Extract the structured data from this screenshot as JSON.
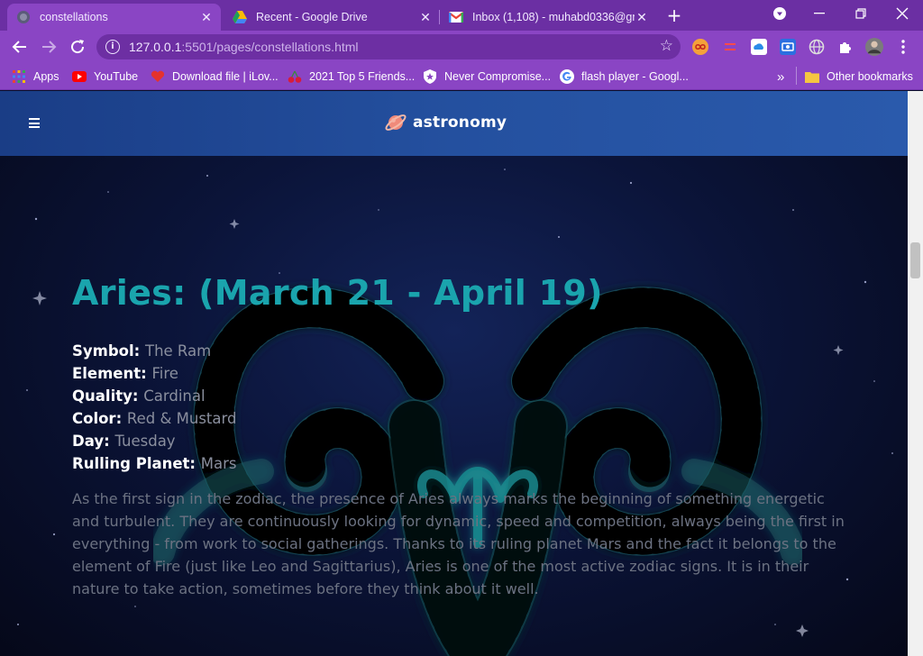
{
  "browser": {
    "tabs": [
      {
        "title": "constellations",
        "active": true
      },
      {
        "title": "Recent - Google Drive",
        "active": false
      },
      {
        "title": "Inbox (1,108) - muhabd0336@gn",
        "active": false
      }
    ],
    "url_host": "127.0.0.1",
    "url_rest": ":5501/pages/constellations.html",
    "bookmarks": [
      {
        "label": "Apps",
        "icon": "apps-grid-icon"
      },
      {
        "label": "YouTube",
        "icon": "youtube-icon"
      },
      {
        "label": "Download file | iLov...",
        "icon": "heart-icon"
      },
      {
        "label": "2021 Top 5 Friends...",
        "icon": "cherries-icon"
      },
      {
        "label": "Never Compromise...",
        "icon": "shield-icon"
      },
      {
        "label": "flash player - Googl...",
        "icon": "google-icon"
      }
    ],
    "other_bookmarks": "Other bookmarks",
    "overflow": "»"
  },
  "site": {
    "logo_text": "astronomy"
  },
  "sign": {
    "title": "Aries: (March 21 - April 19)",
    "facts": [
      {
        "label": "Symbol:",
        "value": "The Ram"
      },
      {
        "label": "Element:",
        "value": "Fire"
      },
      {
        "label": "Quality:",
        "value": "Cardinal"
      },
      {
        "label": "Color:",
        "value": "Red & Mustard"
      },
      {
        "label": "Day:",
        "value": "Tuesday"
      },
      {
        "label": "Rulling Planet:",
        "value": "Mars"
      }
    ],
    "description": "As the first sign in the zodiac, the presence of Aries always marks the beginning of something energetic and turbulent. They are continuously looking for dynamic, speed and competition, always being the first in everything - from work to social gatherings. Thanks to its ruling planet Mars and the fact it belongs to the element of Fire (just like Leo and Sagittarius), Aries is one of the most active zodiac signs. It is in their nature to take action, sometimes before they think about it well."
  },
  "colors": {
    "accent_title": "#1aa4ad",
    "browser_frame": "#8a45c4",
    "header_blue": "#24509f"
  }
}
